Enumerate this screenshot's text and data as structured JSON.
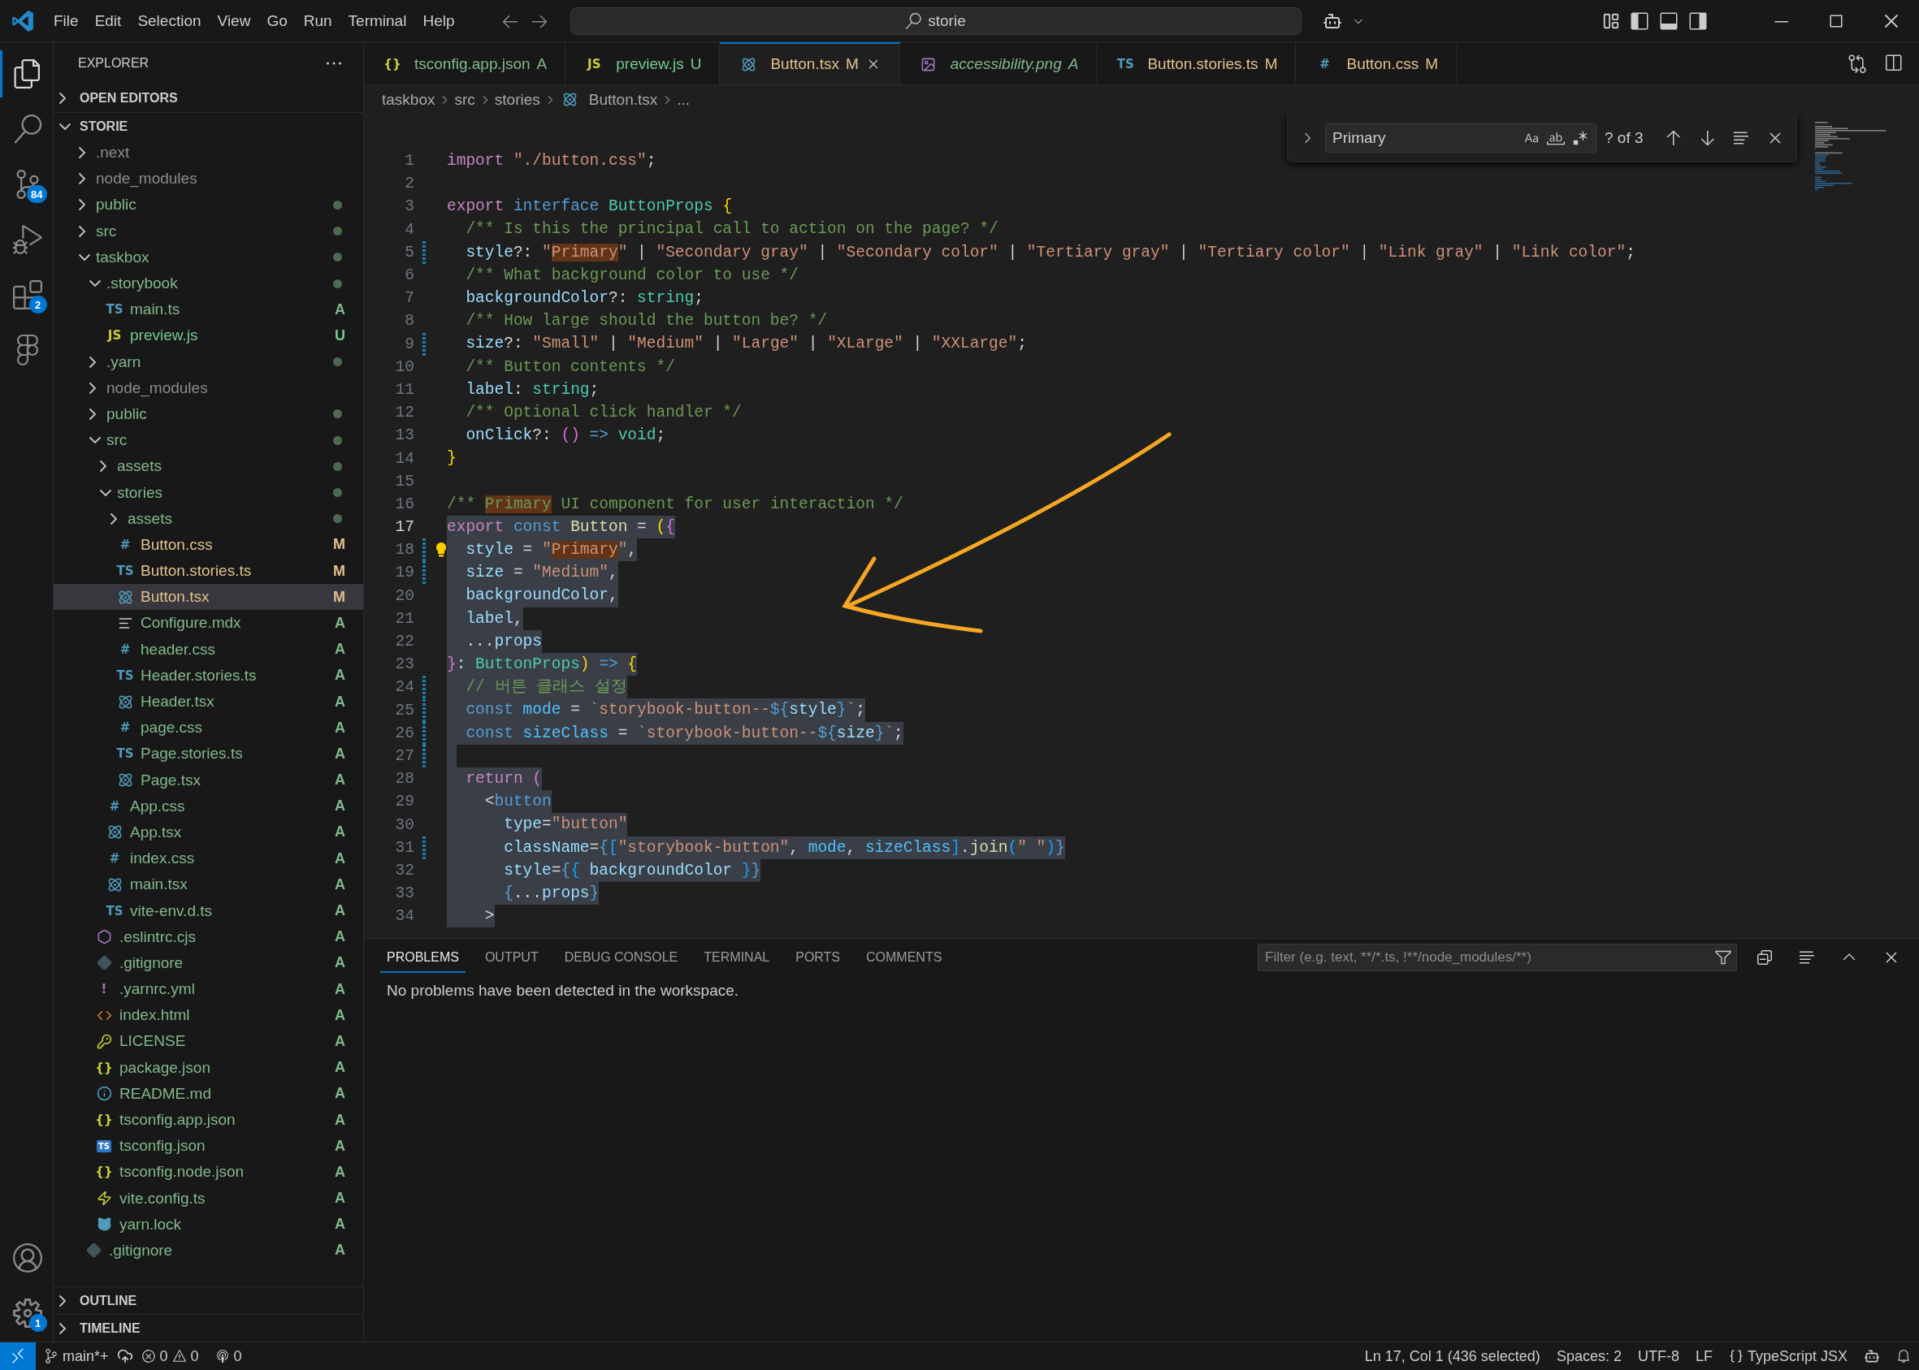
{
  "title_bar": {
    "menu": [
      "File",
      "Edit",
      "Selection",
      "View",
      "Go",
      "Run",
      "Terminal",
      "Help"
    ],
    "search": "storie"
  },
  "activity_bar": {
    "items": [
      {
        "kind": "explorer",
        "selected": true
      },
      {
        "kind": "search",
        "selected": false
      },
      {
        "kind": "scm",
        "selected": false,
        "badge": "84"
      },
      {
        "kind": "debug",
        "selected": false
      },
      {
        "kind": "extensions",
        "selected": false,
        "badge": "2"
      },
      {
        "kind": "figma",
        "selected": false
      }
    ],
    "bottom": [
      {
        "kind": "account"
      },
      {
        "kind": "settings",
        "badge": "1"
      }
    ]
  },
  "sidebar": {
    "title": "EXPLORER",
    "sections": [
      "OPEN EDITORS"
    ],
    "root": "STORIE",
    "bottom_sections": [
      "OUTLINE",
      "TIMELINE"
    ],
    "tree": [
      {
        "label": ".next",
        "kind": "folder",
        "expanded": false,
        "dot": false,
        "color": "#8c8c8c",
        "selected": false
      },
      {
        "label": "node_modules",
        "kind": "folder",
        "expanded": false,
        "dot": false,
        "color": "#8c8c8c",
        "selected": false
      },
      {
        "label": "public",
        "kind": "folder",
        "expanded": false,
        "dot": true,
        "color": "#81b88b",
        "selected": false
      },
      {
        "label": "src",
        "kind": "folder",
        "expanded": false,
        "dot": true,
        "color": "#81b88b",
        "selected": false
      },
      {
        "label": "taskbox",
        "kind": "folder",
        "expanded": true,
        "dot": true,
        "color": "#81b88b",
        "selected": false,
        "children": [
          {
            "label": ".storybook",
            "kind": "folder",
            "expanded": true,
            "dot": true,
            "color": "#81b88b",
            "selected": false,
            "children": [
              {
                "label": "main.ts",
                "kind": "ts",
                "glyph": "TS",
                "status": "A",
                "color": "#81b88b",
                "selected": false
              },
              {
                "label": "preview.js",
                "kind": "js",
                "glyph": "JS",
                "status": "U",
                "color": "#73c991",
                "selected": false
              }
            ]
          },
          {
            "label": ".yarn",
            "kind": "folder",
            "expanded": false,
            "dot": true,
            "color": "#81b88b",
            "selected": false
          },
          {
            "label": "node_modules",
            "kind": "folder",
            "expanded": false,
            "dot": false,
            "color": "#8c8c8c",
            "selected": false
          },
          {
            "label": "public",
            "kind": "folder",
            "expanded": false,
            "dot": true,
            "color": "#81b88b",
            "selected": false
          },
          {
            "label": "src",
            "kind": "folder",
            "expanded": true,
            "dot": true,
            "color": "#81b88b",
            "selected": false,
            "children": [
              {
                "label": "assets",
                "kind": "folder",
                "expanded": false,
                "dot": true,
                "color": "#81b88b",
                "selected": false
              },
              {
                "label": "stories",
                "kind": "folder",
                "expanded": true,
                "dot": true,
                "color": "#81b88b",
                "selected": false,
                "children": [
                  {
                    "label": "assets",
                    "kind": "folder",
                    "expanded": false,
                    "dot": true,
                    "color": "#81b88b",
                    "selected": false
                  },
                  {
                    "label": "Button.css",
                    "kind": "css",
                    "glyph": "#",
                    "status": "M",
                    "color": "#e2c08d",
                    "selected": false
                  },
                  {
                    "label": "Button.stories.ts",
                    "kind": "ts",
                    "glyph": "TS",
                    "status": "M",
                    "color": "#e2c08d",
                    "selected": false
                  },
                  {
                    "label": "Button.tsx",
                    "kind": "react",
                    "status": "M",
                    "color": "#e2c08d",
                    "selected": true
                  },
                  {
                    "label": "Configure.mdx",
                    "kind": "mdx",
                    "status": "A",
                    "color": "#81b88b",
                    "selected": false
                  },
                  {
                    "label": "header.css",
                    "kind": "css",
                    "glyph": "#",
                    "status": "A",
                    "color": "#81b88b",
                    "selected": false
                  },
                  {
                    "label": "Header.stories.ts",
                    "kind": "ts",
                    "glyph": "TS",
                    "status": "A",
                    "color": "#81b88b",
                    "selected": false
                  },
                  {
                    "label": "Header.tsx",
                    "kind": "react",
                    "status": "A",
                    "color": "#81b88b",
                    "selected": false
                  },
                  {
                    "label": "page.css",
                    "kind": "css",
                    "glyph": "#",
                    "status": "A",
                    "color": "#81b88b",
                    "selected": false
                  },
                  {
                    "label": "Page.stories.ts",
                    "kind": "ts",
                    "glyph": "TS",
                    "status": "A",
                    "color": "#81b88b",
                    "selected": false
                  },
                  {
                    "label": "Page.tsx",
                    "kind": "react",
                    "status": "A",
                    "color": "#81b88b",
                    "selected": false
                  }
                ]
              },
              {
                "label": "App.css",
                "kind": "css",
                "glyph": "#",
                "status": "A",
                "color": "#81b88b",
                "selected": false
              },
              {
                "label": "App.tsx",
                "kind": "react",
                "status": "A",
                "color": "#81b88b",
                "selected": false
              },
              {
                "label": "index.css",
                "kind": "css",
                "glyph": "#",
                "status": "A",
                "color": "#81b88b",
                "selected": false
              },
              {
                "label": "main.tsx",
                "kind": "react",
                "status": "A",
                "color": "#81b88b",
                "selected": false
              },
              {
                "label": "vite-env.d.ts",
                "kind": "ts",
                "glyph": "TS",
                "status": "A",
                "color": "#81b88b",
                "selected": false
              }
            ]
          },
          {
            "label": ".eslintrc.cjs",
            "kind": "eslint",
            "status": "A",
            "color": "#81b88b",
            "selected": false
          },
          {
            "label": ".gitignore",
            "kind": "git",
            "status": "A",
            "color": "#81b88b",
            "selected": false
          },
          {
            "label": ".yarnrc.yml",
            "kind": "yaml",
            "glyph": "!",
            "status": "A",
            "color": "#81b88b",
            "selected": false
          },
          {
            "label": "index.html",
            "kind": "html",
            "status": "A",
            "color": "#81b88b",
            "selected": false
          },
          {
            "label": "LICENSE",
            "kind": "license",
            "status": "A",
            "color": "#81b88b",
            "selected": false
          },
          {
            "label": "package.json",
            "kind": "json",
            "glyph": "{}",
            "status": "A",
            "color": "#81b88b",
            "selected": false
          },
          {
            "label": "README.md",
            "kind": "info",
            "status": "A",
            "color": "#81b88b",
            "selected": false
          },
          {
            "label": "tsconfig.app.json",
            "kind": "json",
            "glyph": "{}",
            "status": "A",
            "color": "#81b88b",
            "selected": false
          },
          {
            "label": "tsconfig.json",
            "kind": "tsbox",
            "glyph": "TS",
            "status": "A",
            "color": "#81b88b",
            "selected": false
          },
          {
            "label": "tsconfig.node.json",
            "kind": "json",
            "glyph": "{}",
            "status": "A",
            "color": "#81b88b",
            "selected": false
          },
          {
            "label": "vite.config.ts",
            "kind": "vite",
            "status": "A",
            "color": "#81b88b",
            "selected": false
          },
          {
            "label": "yarn.lock",
            "kind": "yarn",
            "status": "A",
            "color": "#81b88b",
            "selected": false
          }
        ]
      },
      {
        "label": ".gitignore",
        "kind": "git",
        "status": "A",
        "color": "#81b88b",
        "selected": false
      }
    ]
  },
  "tabs": [
    {
      "label": "tsconfig.app.json",
      "kind": "json",
      "glyph": "{}",
      "status": "A",
      "color": "#81b88b",
      "selected": false,
      "preview": false
    },
    {
      "label": "preview.js",
      "kind": "js",
      "glyph": "JS",
      "status": "U",
      "color": "#73c991",
      "selected": false,
      "preview": false
    },
    {
      "label": "Button.tsx",
      "kind": "react",
      "status": "M",
      "color": "#e2c08d",
      "selected": true,
      "preview": false
    },
    {
      "label": "accessibility.png",
      "kind": "image",
      "status": "A",
      "color": "#81b88b",
      "selected": false,
      "preview": true
    },
    {
      "label": "Button.stories.ts",
      "kind": "ts",
      "glyph": "TS",
      "status": "M",
      "color": "#e2c08d",
      "selected": false,
      "preview": false
    },
    {
      "label": "Button.css",
      "kind": "css",
      "glyph": "#",
      "status": "M",
      "color": "#e2c08d",
      "selected": false,
      "preview": false
    }
  ],
  "breadcrumb": [
    {
      "label": "taskbox",
      "kind": "folder"
    },
    {
      "label": "src",
      "kind": "folder"
    },
    {
      "label": "stories",
      "kind": "folder"
    },
    {
      "label": "Button.tsx",
      "kind": "react"
    },
    {
      "label": "...",
      "kind": "more"
    }
  ],
  "find": {
    "value": "Primary",
    "count": "? of 3"
  },
  "code": [
    {
      "n": "1",
      "tokens": [
        {
          "kind": "kw",
          "text": "import"
        },
        {
          "kind": "s",
          "text": " \"./button.css\""
        },
        {
          "kind": "p",
          "text": ";"
        }
      ]
    },
    {
      "n": "2"
    },
    {
      "n": "3",
      "tokens": [
        {
          "kind": "kw",
          "text": "export"
        },
        {
          "kind": "st",
          "text": " interface"
        },
        {
          "kind": "ty",
          "text": " ButtonProps"
        },
        {
          "kind": "b1",
          "text": " {"
        }
      ]
    },
    {
      "n": "4",
      "tokens": [
        {
          "kind": "c",
          "text": "  /** Is this the principal call to action on the page? */"
        }
      ]
    },
    {
      "n": "5",
      "modified": true,
      "tokens": [
        {
          "kind": "v",
          "text": "  style"
        },
        {
          "kind": "p",
          "text": "?: "
        },
        {
          "kind": "s",
          "text": "\""
        },
        {
          "kind": "m",
          "text": "Primary"
        },
        {
          "kind": "s",
          "text": "\""
        },
        {
          "kind": "p",
          "text": " | "
        },
        {
          "kind": "s",
          "text": "\"Secondary gray\""
        },
        {
          "kind": "p",
          "text": " | "
        },
        {
          "kind": "s",
          "text": "\"Secondary color\""
        },
        {
          "kind": "p",
          "text": " | "
        },
        {
          "kind": "s",
          "text": "\"Tertiary gray\""
        },
        {
          "kind": "p",
          "text": " | "
        },
        {
          "kind": "s",
          "text": "\"Tertiary color\""
        },
        {
          "kind": "p",
          "text": " | "
        },
        {
          "kind": "s",
          "text": "\"Link gray\""
        },
        {
          "kind": "p",
          "text": " | "
        },
        {
          "kind": "s",
          "text": "\"Link color\""
        },
        {
          "kind": "p",
          "text": ";"
        }
      ]
    },
    {
      "n": "6",
      "tokens": [
        {
          "kind": "c",
          "text": "  /** What background color to use */"
        }
      ]
    },
    {
      "n": "7",
      "tokens": [
        {
          "kind": "v",
          "text": "  backgroundColor"
        },
        {
          "kind": "p",
          "text": "?: "
        },
        {
          "kind": "ty",
          "text": "string"
        },
        {
          "kind": "p",
          "text": ";"
        }
      ]
    },
    {
      "n": "8",
      "tokens": [
        {
          "kind": "c",
          "text": "  /** How large should the button be? */"
        }
      ]
    },
    {
      "n": "9",
      "modified": true,
      "tokens": [
        {
          "kind": "v",
          "text": "  size"
        },
        {
          "kind": "p",
          "text": "?: "
        },
        {
          "kind": "s",
          "text": "\"Small\""
        },
        {
          "kind": "p",
          "text": " | "
        },
        {
          "kind": "s",
          "text": "\"Medium\""
        },
        {
          "kind": "p",
          "text": " | "
        },
        {
          "kind": "s",
          "text": "\"Large\""
        },
        {
          "kind": "p",
          "text": " | "
        },
        {
          "kind": "s",
          "text": "\"XLarge\""
        },
        {
          "kind": "p",
          "text": " | "
        },
        {
          "kind": "s",
          "text": "\"XXLarge\""
        },
        {
          "kind": "p",
          "text": ";"
        }
      ]
    },
    {
      "n": "10",
      "tokens": [
        {
          "kind": "c",
          "text": "  /** Button contents */"
        }
      ]
    },
    {
      "n": "11",
      "tokens": [
        {
          "kind": "v",
          "text": "  label"
        },
        {
          "kind": "p",
          "text": ": "
        },
        {
          "kind": "ty",
          "text": "string"
        },
        {
          "kind": "p",
          "text": ";"
        }
      ]
    },
    {
      "n": "12",
      "tokens": [
        {
          "kind": "c",
          "text": "  /** Optional click handler */"
        }
      ]
    },
    {
      "n": "13",
      "tokens": [
        {
          "kind": "v",
          "text": "  onClick"
        },
        {
          "kind": "p",
          "text": "?: "
        },
        {
          "kind": "b2",
          "text": "()"
        },
        {
          "kind": "st",
          "text": " =>"
        },
        {
          "kind": "ty",
          "text": " void"
        },
        {
          "kind": "p",
          "text": ";"
        }
      ]
    },
    {
      "n": "14",
      "tokens": [
        {
          "kind": "b1",
          "text": "}"
        }
      ]
    },
    {
      "n": "15"
    },
    {
      "n": "16",
      "tokens": [
        {
          "kind": "c",
          "text": "/** "
        },
        {
          "kind": "mc",
          "text": "Primary"
        },
        {
          "kind": "c",
          "text": " UI component for user interaction */"
        }
      ]
    },
    {
      "n": "17",
      "current": true,
      "selected": true,
      "tokens": [
        {
          "kind": "kw",
          "text": "export"
        },
        {
          "kind": "st",
          "text": " const"
        },
        {
          "kind": "f",
          "text": " Button"
        },
        {
          "kind": "p",
          "text": " = "
        },
        {
          "kind": "b1",
          "text": "("
        },
        {
          "kind": "b2",
          "text": "{"
        }
      ]
    },
    {
      "n": "18",
      "current": false,
      "selected": true,
      "modified": true,
      "lightbulb": true,
      "tokens": [
        {
          "kind": "v",
          "text": "  style"
        },
        {
          "kind": "p",
          "text": " = "
        },
        {
          "kind": "s",
          "text": "\""
        },
        {
          "kind": "m",
          "text": "Primary"
        },
        {
          "kind": "s",
          "text": "\""
        },
        {
          "kind": "p",
          "text": ","
        }
      ]
    },
    {
      "n": "19",
      "current": false,
      "selected": true,
      "modified": true,
      "tokens": [
        {
          "kind": "v",
          "text": "  size"
        },
        {
          "kind": "p",
          "text": " = "
        },
        {
          "kind": "s",
          "text": "\"Medium\""
        },
        {
          "kind": "p",
          "text": ","
        }
      ]
    },
    {
      "n": "20",
      "current": false,
      "selected": true,
      "tokens": [
        {
          "kind": "v",
          "text": "  backgroundColor"
        },
        {
          "kind": "p",
          "text": ","
        }
      ]
    },
    {
      "n": "21",
      "current": false,
      "selected": true,
      "tokens": [
        {
          "kind": "v",
          "text": "  label"
        },
        {
          "kind": "p",
          "text": ","
        }
      ]
    },
    {
      "n": "22",
      "current": false,
      "selected": true,
      "tokens": [
        {
          "kind": "p",
          "text": "  ..."
        },
        {
          "kind": "v",
          "text": "props"
        }
      ]
    },
    {
      "n": "23",
      "current": false,
      "selected": true,
      "tokens": [
        {
          "kind": "b2",
          "text": "}"
        },
        {
          "kind": "p",
          "text": ": "
        },
        {
          "kind": "ty",
          "text": "ButtonProps"
        },
        {
          "kind": "b1",
          "text": ")"
        },
        {
          "kind": "st",
          "text": " =>"
        },
        {
          "kind": "b1",
          "text": " {"
        }
      ]
    },
    {
      "n": "24",
      "current": false,
      "selected": true,
      "modified": true,
      "tokens": [
        {
          "kind": "c",
          "text": "  // 버튼 클래스 설정"
        }
      ]
    },
    {
      "n": "25",
      "current": false,
      "selected": true,
      "modified": true,
      "tokens": [
        {
          "kind": "st",
          "text": "  const"
        },
        {
          "kind": "v2",
          "text": " mode"
        },
        {
          "kind": "p",
          "text": " = "
        },
        {
          "kind": "s",
          "text": "`storybook-button--"
        },
        {
          "kind": "st",
          "text": "${"
        },
        {
          "kind": "v",
          "text": "style"
        },
        {
          "kind": "st",
          "text": "}"
        },
        {
          "kind": "s",
          "text": "`"
        },
        {
          "kind": "p",
          "text": ";"
        }
      ]
    },
    {
      "n": "26",
      "current": false,
      "selected": true,
      "modified": true,
      "tokens": [
        {
          "kind": "st",
          "text": "  const"
        },
        {
          "kind": "v2",
          "text": " sizeClass"
        },
        {
          "kind": "p",
          "text": " = "
        },
        {
          "kind": "s",
          "text": "`storybook-button--"
        },
        {
          "kind": "st",
          "text": "${"
        },
        {
          "kind": "v",
          "text": "size"
        },
        {
          "kind": "st",
          "text": "}"
        },
        {
          "kind": "s",
          "text": "`"
        },
        {
          "kind": "p",
          "text": ";"
        }
      ]
    },
    {
      "n": "27",
      "current": false,
      "selected": true,
      "modified": true
    },
    {
      "n": "28",
      "current": false,
      "selected": true,
      "tokens": [
        {
          "kind": "kw",
          "text": "  return"
        },
        {
          "kind": "b2",
          "text": " ("
        }
      ]
    },
    {
      "n": "29",
      "current": false,
      "selected": true,
      "tokens": [
        {
          "kind": "p",
          "text": "    <"
        },
        {
          "kind": "tag",
          "text": "button"
        }
      ]
    },
    {
      "n": "30",
      "current": false,
      "selected": true,
      "tokens": [
        {
          "kind": "v",
          "text": "      type"
        },
        {
          "kind": "p",
          "text": "="
        },
        {
          "kind": "s",
          "text": "\"button\""
        }
      ]
    },
    {
      "n": "31",
      "current": false,
      "selected": true,
      "modified": true,
      "tokens": [
        {
          "kind": "v",
          "text": "      className"
        },
        {
          "kind": "p",
          "text": "="
        },
        {
          "kind": "st",
          "text": "{"
        },
        {
          "kind": "b3",
          "text": "["
        },
        {
          "kind": "s",
          "text": "\"storybook-button\""
        },
        {
          "kind": "p",
          "text": ", "
        },
        {
          "kind": "v2",
          "text": "mode"
        },
        {
          "kind": "p",
          "text": ", "
        },
        {
          "kind": "v2",
          "text": "sizeClass"
        },
        {
          "kind": "b3",
          "text": "]"
        },
        {
          "kind": "p",
          "text": "."
        },
        {
          "kind": "f",
          "text": "join"
        },
        {
          "kind": "b3",
          "text": "("
        },
        {
          "kind": "s",
          "text": "\" \""
        },
        {
          "kind": "b3",
          "text": ")"
        },
        {
          "kind": "st",
          "text": "}"
        }
      ]
    },
    {
      "n": "32",
      "current": false,
      "selected": true,
      "tokens": [
        {
          "kind": "v",
          "text": "      style"
        },
        {
          "kind": "p",
          "text": "="
        },
        {
          "kind": "st",
          "text": "{"
        },
        {
          "kind": "b3",
          "text": "{"
        },
        {
          "kind": "v",
          "text": " backgroundColor"
        },
        {
          "kind": "b3",
          "text": " }"
        },
        {
          "kind": "st",
          "text": "}"
        }
      ]
    },
    {
      "n": "33",
      "current": false,
      "selected": true,
      "tokens": [
        {
          "kind": "st",
          "text": "      {"
        },
        {
          "kind": "p",
          "text": "..."
        },
        {
          "kind": "v",
          "text": "props"
        },
        {
          "kind": "st",
          "text": "}"
        }
      ]
    },
    {
      "n": "34",
      "current": false,
      "selected": true,
      "tokens": [
        {
          "kind": "p",
          "text": "    >"
        }
      ]
    }
  ],
  "panel": {
    "tabs": [
      {
        "label": "PROBLEMS",
        "selected": true
      },
      {
        "label": "OUTPUT",
        "selected": false
      },
      {
        "label": "DEBUG CONSOLE",
        "selected": false
      },
      {
        "label": "TERMINAL",
        "selected": false
      },
      {
        "label": "PORTS",
        "selected": false
      },
      {
        "label": "COMMENTS",
        "selected": false
      }
    ],
    "filter_placeholder": "Filter (e.g. text, **/*.ts, !**/node_modules/**)",
    "message": "No problems have been detected in the workspace."
  },
  "status_bar": {
    "branch": "main*+",
    "errors": "0",
    "warnings": "0",
    "ports": "0",
    "position": "Ln 17, Col 1 (436 selected)",
    "spaces": "Spaces: 2",
    "encoding": "UTF-8",
    "eol": "LF",
    "language": "TypeScript JSX"
  }
}
